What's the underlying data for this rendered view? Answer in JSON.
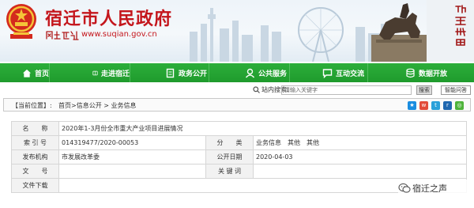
{
  "header": {
    "site_title": "宿迁市人民政府",
    "site_url": "www.suqian.gov.cn",
    "slogan_calligraphy": "网上宿迁",
    "right_calligraphy": "项王故里"
  },
  "nav": [
    {
      "label": "首页",
      "icon": "home-icon"
    },
    {
      "label": "走进宿迁",
      "icon": "book-icon"
    },
    {
      "label": "政务公开",
      "icon": "document-icon"
    },
    {
      "label": "公共服务",
      "icon": "service-icon"
    },
    {
      "label": "互动交流",
      "icon": "chat-icon"
    },
    {
      "label": "数据开放",
      "icon": "data-icon"
    }
  ],
  "search": {
    "label": "站内搜索:",
    "placeholder": "请输入关键字",
    "button": "搜索",
    "elder_button": "智能问答"
  },
  "breadcrumb": {
    "label": "【当前位置】:",
    "path": "首页>信息公开 > 业务信息"
  },
  "info": {
    "name_label": "名　　称",
    "name_value": "2020年1-3月份全市重大产业项目进展情况",
    "index_label": "索 引 号",
    "index_value": "014319477/2020-00053",
    "category_label": "分　　类",
    "category_value": "业务信息　其他　其他",
    "publisher_label": "发布机构",
    "publisher_value": "市发展改革委",
    "date_label": "公开日期",
    "date_value": "2020-04-03",
    "doc_label": "文　　号",
    "doc_value": "",
    "keyword_label": "关 键 词",
    "keyword_value": "",
    "download_label": "文件下载",
    "download_value": ""
  },
  "watermark": {
    "text": "宿迁之声"
  },
  "colors": {
    "brand_red": "#c4161c",
    "nav_green": "#22a131"
  }
}
